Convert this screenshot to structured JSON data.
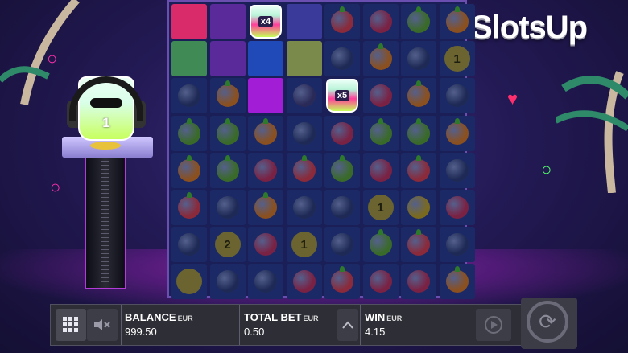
{
  "logo": {
    "text": "SlotsUp"
  },
  "character": {
    "count": "1"
  },
  "grid": {
    "jars": [
      {
        "multiplier": "x4"
      },
      {
        "multiplier": "x5"
      }
    ],
    "coin_labels": [
      "1",
      "1",
      "2",
      "1"
    ]
  },
  "bottom_bar": {
    "menu_icon": "grid-menu-icon",
    "sound_icon": "mute-speaker-icon",
    "balance_label": "BALANCE",
    "balance_currency": "EUR",
    "balance_value": "999.50",
    "total_bet_label": "TOTAL BET",
    "total_bet_currency": "EUR",
    "total_bet_value": "0.50",
    "bet_up_icon": "chevron-up-icon",
    "win_label": "WIN",
    "win_currency": "EUR",
    "win_value": "4.15",
    "autoplay_icon": "autoplay-icon",
    "spin_icon": "spin-arrows-icon"
  }
}
